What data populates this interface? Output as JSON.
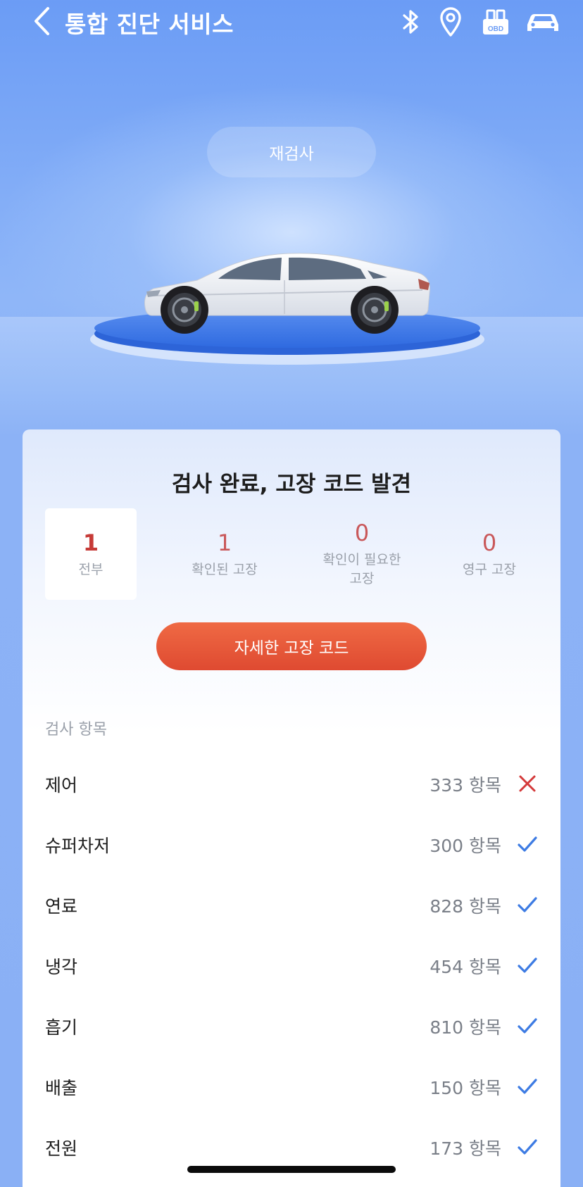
{
  "header": {
    "title": "통합 진단 서비스",
    "icons": [
      "back-chevron-icon",
      "bluetooth-icon",
      "location-pin-icon",
      "obd-icon",
      "car-icon"
    ],
    "obd_label": "OBD"
  },
  "recheck_label": "재검사",
  "summary": {
    "title": "검사 완료,  고장 코드 발견",
    "stats": [
      {
        "value": "1",
        "label": "전부"
      },
      {
        "value": "1",
        "label": "확인된 고장"
      },
      {
        "value": "0",
        "label": "확인이 필요한 고장"
      },
      {
        "value": "0",
        "label": "영구 고장"
      }
    ],
    "detail_button": "자세한 고장 코드"
  },
  "inspection": {
    "section_label": "검사 항목",
    "items": [
      {
        "name": "제어",
        "count": "333 항목",
        "status": "fail"
      },
      {
        "name": "슈퍼차저",
        "count": "300 항목",
        "status": "pass"
      },
      {
        "name": "연료",
        "count": "828 항목",
        "status": "pass"
      },
      {
        "name": "냉각",
        "count": "454 항목",
        "status": "pass"
      },
      {
        "name": "흡기",
        "count": "810 항목",
        "status": "pass"
      },
      {
        "name": "배출",
        "count": "150 항목",
        "status": "pass"
      },
      {
        "name": "전원",
        "count": "173 항목",
        "status": "pass"
      }
    ]
  },
  "colors": {
    "accent_blue": "#3d7be3",
    "fault_red": "#d4393a",
    "button_orange": "#e55a38"
  }
}
